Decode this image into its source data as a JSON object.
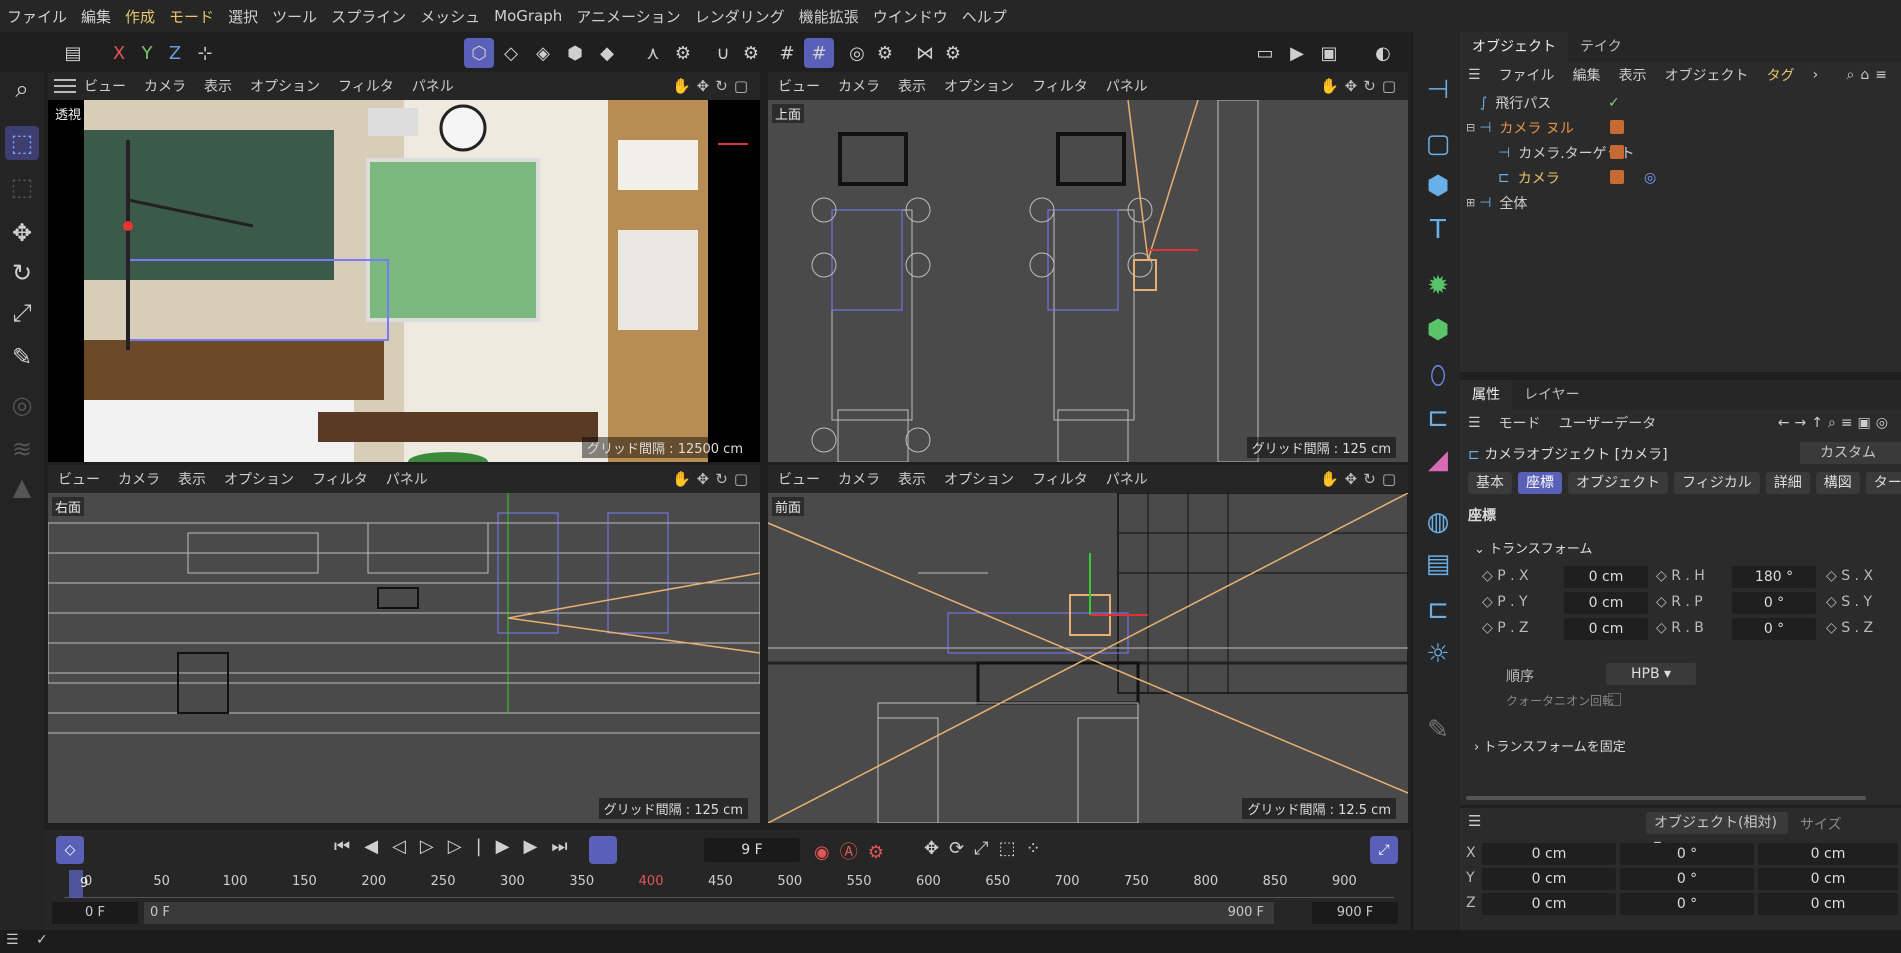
{
  "menu": [
    "ファイル",
    "編集",
    "作成",
    "モード",
    "選択",
    "ツール",
    "スプライン",
    "メッシュ",
    "MoGraph",
    "アニメーション",
    "レンダリング",
    "機能拡張",
    "ウインドウ",
    "ヘルプ"
  ],
  "menu_active": [
    "作成",
    "モード"
  ],
  "toolbar": {
    "x": "X",
    "y": "Y",
    "z": "Z"
  },
  "viewport_menu": [
    "ビュー",
    "カメラ",
    "表示",
    "オプション",
    "フィルタ",
    "パネル"
  ],
  "viewports": [
    {
      "label": "透視",
      "grid": "グリッド間隔 : 12500 cm"
    },
    {
      "label": "上面",
      "grid": "グリッド間隔 : 125 cm"
    },
    {
      "label": "右面",
      "grid": "グリッド間隔 : 125 cm"
    },
    {
      "label": "前面",
      "grid": "グリッド間隔 : 12.5 cm"
    }
  ],
  "timeline": {
    "frame": "9 F",
    "ticks": [
      "0",
      "50",
      "100",
      "150",
      "200",
      "250",
      "300",
      "350",
      "400",
      "450",
      "500",
      "550",
      "600",
      "650",
      "700",
      "750",
      "800",
      "850",
      "900"
    ],
    "current_tick": "9",
    "start": "0 F",
    "range_start": "0 F",
    "range_end": "900 F",
    "end": "900 F"
  },
  "objects": {
    "tabs": [
      "オブジェクト",
      "テイク"
    ],
    "menu": [
      "ファイル",
      "編集",
      "表示",
      "オブジェクト",
      "タグ"
    ],
    "items": [
      {
        "name": "飛行パス",
        "color": "#d0d0d0"
      },
      {
        "name": "カメラ ヌル",
        "color": "#e8934a"
      },
      {
        "name": "カメラ.ターゲット",
        "color": "#d0d0d0"
      },
      {
        "name": "カメラ",
        "color": "#e8c56a"
      },
      {
        "name": "全体",
        "color": "#d0d0d0"
      }
    ]
  },
  "attributes": {
    "tabs": [
      "属性",
      "レイヤー"
    ],
    "menu": [
      "モード",
      "ユーザーデータ"
    ],
    "object_title": "カメラオブジェクト [カメラ]",
    "preset": "カスタム",
    "chips": [
      "基本",
      "座標",
      "オブジェクト",
      "フィジカル",
      "詳細",
      "構図",
      "ターゲット"
    ],
    "active_chip": "座標",
    "section": "座標",
    "group": "トランスフォーム",
    "rows": [
      {
        "p_label": "P . X",
        "p": "0 cm",
        "r_label": "R . H",
        "r": "180 °",
        "s_label": "S . X"
      },
      {
        "p_label": "P . Y",
        "p": "0 cm",
        "r_label": "R . P",
        "r": "0 °",
        "s_label": "S . Y"
      },
      {
        "p_label": "P . Z",
        "p": "0 cm",
        "r_label": "R . B",
        "r": "0 °",
        "s_label": "S . Z"
      }
    ],
    "order_label": "順序",
    "order_value": "HPB",
    "quat_label": "クォータニオン回転",
    "freeze": "トランスフォームを固定"
  },
  "coords": {
    "mode": "オブジェクト(相対)",
    "size_label": "サイズ",
    "rows": [
      {
        "axis": "X",
        "a": "0 cm",
        "b": "0 °",
        "c": "0 cm"
      },
      {
        "axis": "Y",
        "a": "0 cm",
        "b": "0 °",
        "c": "0 cm"
      },
      {
        "axis": "Z",
        "a": "0 cm",
        "b": "0 °",
        "c": "0 cm"
      }
    ]
  },
  "colors": {
    "accent": "#5a5fb8",
    "highlight": "#e8c56a",
    "orange": "#c56a30"
  }
}
